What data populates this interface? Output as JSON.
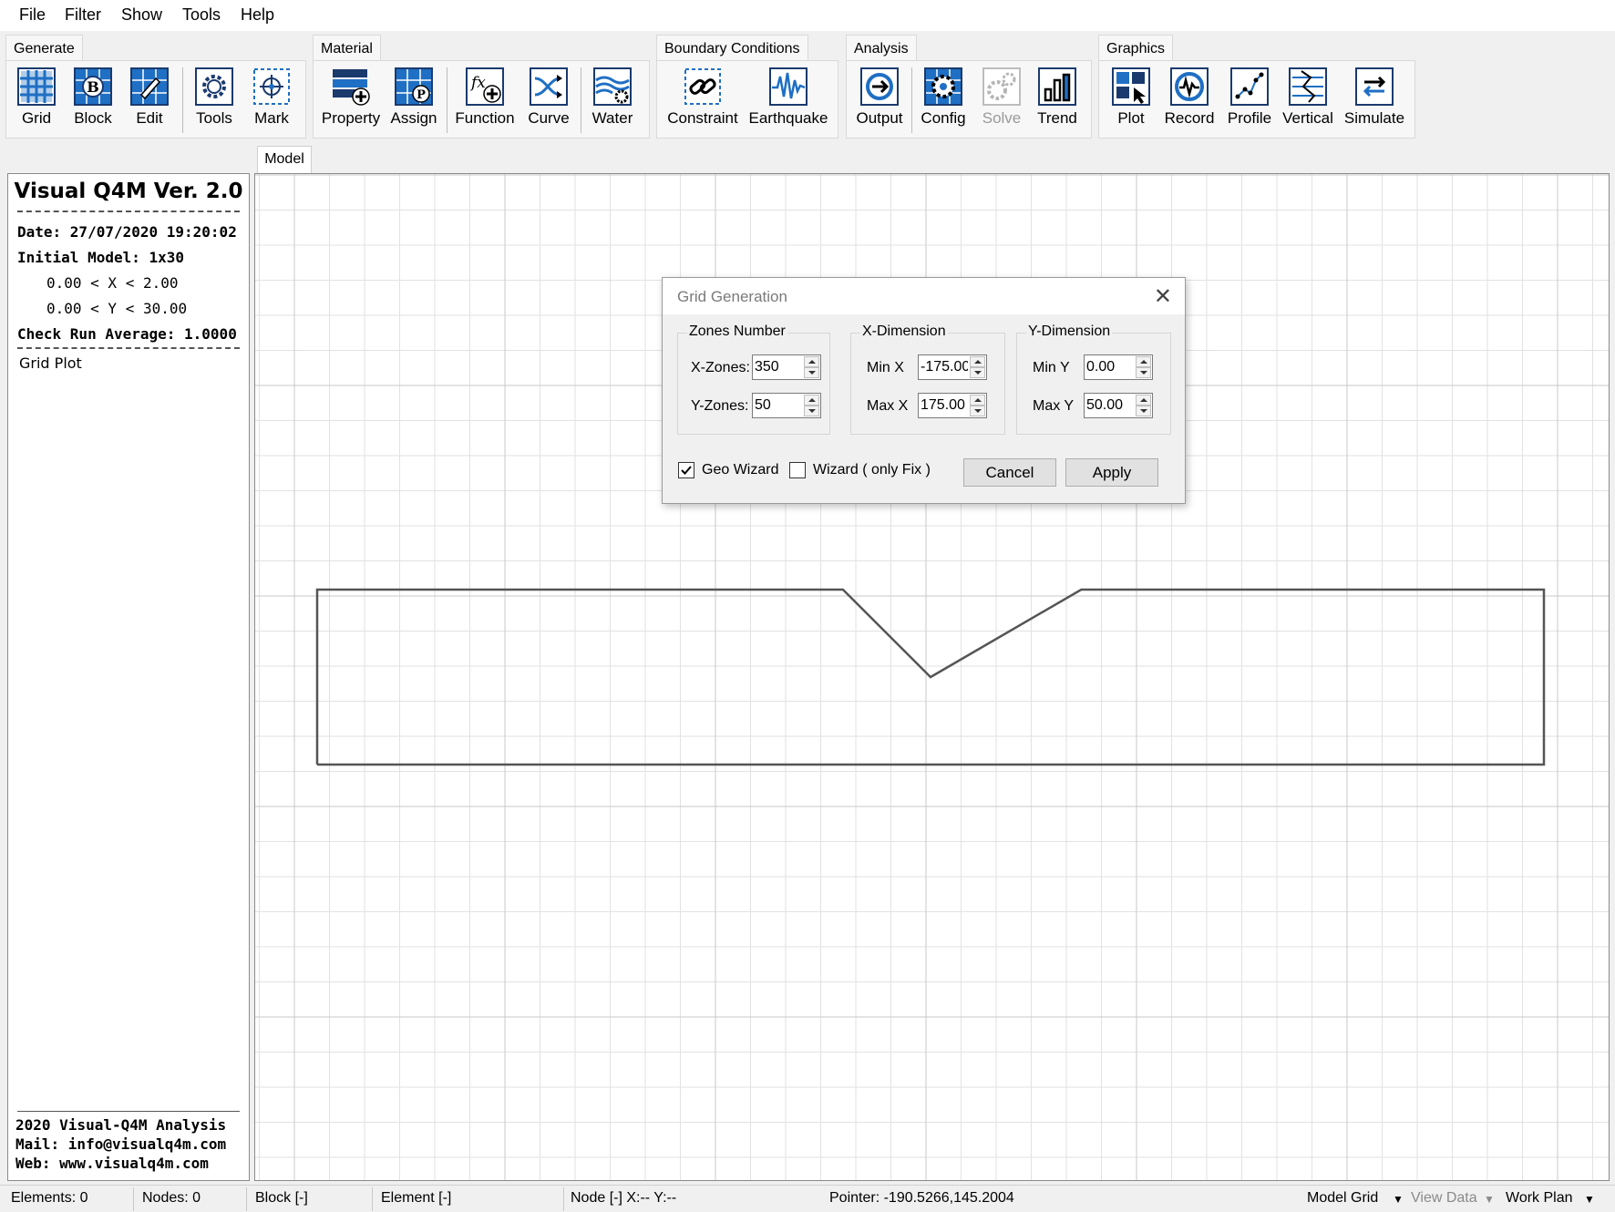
{
  "menu": [
    "File",
    "Filter",
    "Show",
    "Tools",
    "Help"
  ],
  "ribbon": {
    "groups": [
      "Generate",
      "Material",
      "Boundary Conditions",
      "Analysis",
      "Graphics"
    ],
    "buttons": {
      "grid": "Grid",
      "block": "Block",
      "edit": "Edit",
      "tools": "Tools",
      "mark": "Mark",
      "property": "Property",
      "assign": "Assign",
      "function": "Function",
      "curve": "Curve",
      "water": "Water",
      "constraint": "Constraint",
      "earthquake": "Earthquake",
      "output": "Output",
      "config": "Config",
      "solve": "Solve",
      "trend": "Trend",
      "plot": "Plot",
      "record": "Record",
      "profile": "Profile",
      "vertical": "Vertical",
      "simulate": "Simulate"
    },
    "block_glyph": "B",
    "assign_glyph": "P",
    "function_glyph": "fx"
  },
  "model_tab": "Model",
  "left_panel": {
    "title": "Visual Q4M Ver. 2.0",
    "date": "Date: 27/07/2020 19:20:02",
    "initial_model": "Initial Model: 1x30",
    "x_range": "0.00 < X < 2.00",
    "y_range": "0.00 < Y < 30.00",
    "check_run": "Check Run Average: 1.0000",
    "item": "Grid Plot",
    "footer": [
      "2020 Visual-Q4M Analysis",
      "Mail: info@visualq4m.com",
      "Web: www.visualq4m.com"
    ]
  },
  "canvas": {
    "profile": {
      "x_min": -175,
      "x_max": 175,
      "y_top": 50,
      "y_bottom": 0,
      "points": [
        [
          -175,
          0
        ],
        [
          -175,
          50
        ],
        [
          -25,
          50
        ],
        [
          0,
          25
        ],
        [
          43,
          50
        ],
        [
          175,
          50
        ],
        [
          175,
          0
        ]
      ]
    }
  },
  "dialog": {
    "title": "Grid Generation",
    "zones_legend": "Zones Number",
    "xdim_legend": "X-Dimension",
    "ydim_legend": "Y-Dimension",
    "x_zones_label": "X-Zones:",
    "x_zones_value": "350",
    "y_zones_label": "Y-Zones:",
    "y_zones_value": "50",
    "min_x_label": "Min X",
    "min_x_value": "-175.00",
    "max_x_label": "Max X",
    "max_x_value": "175.00",
    "min_y_label": "Min Y",
    "min_y_value": "0.00",
    "max_y_label": "Max Y",
    "max_y_value": "50.00",
    "geo_wizard_label": "Geo Wizard",
    "geo_wizard_checked": true,
    "wizard_fix_label": "Wizard ( only Fix )",
    "wizard_fix_checked": false,
    "cancel": "Cancel",
    "apply": "Apply"
  },
  "status": {
    "elements": "Elements: 0",
    "nodes": "Nodes: 0",
    "block": "Block [-]",
    "element": "Element [-]",
    "node": "Node [-]  X:-- Y:--",
    "pointer": "Pointer: -190.5266,145.2004",
    "model_grid": "Model Grid",
    "view_data": "View Data",
    "work_plan": "Work Plan"
  },
  "colors": {
    "icon_blue": "#1f6fc4",
    "icon_border": "#1a3a6e",
    "grid_minor": "#e2e2e2",
    "grid_major": "#c9c9c9",
    "profile_line": "#555555"
  }
}
